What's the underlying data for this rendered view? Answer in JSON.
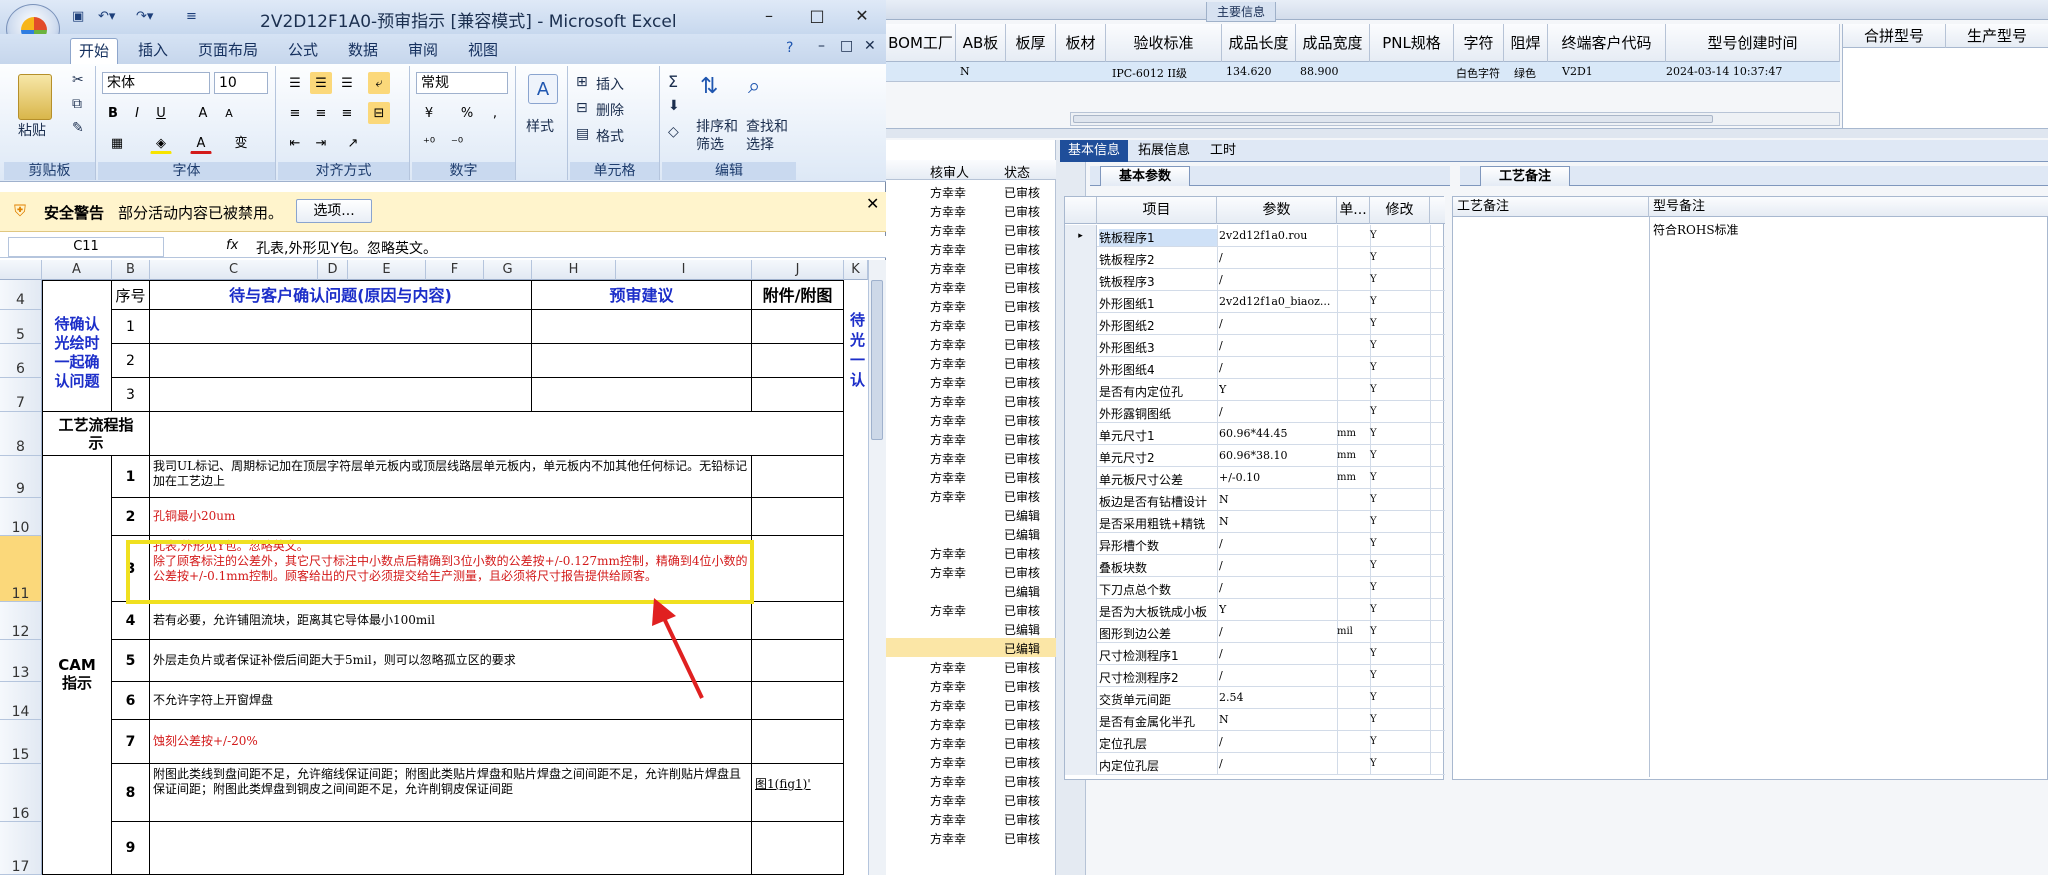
{
  "excel": {
    "title": "2V2D12F1A0-预审指示 [兼容模式] - Microsoft Excel",
    "window_buttons": [
      "–",
      "□",
      "✕"
    ],
    "ribbon_tabs": [
      "开始",
      "插入",
      "页面布局",
      "公式",
      "数据",
      "审阅",
      "视图"
    ],
    "ribbon_minor_icons": [
      "?",
      "–",
      "□",
      "✕"
    ],
    "groups": {
      "clipboard": {
        "label": "剪贴板",
        "paste": "粘贴"
      },
      "font": {
        "label": "字体",
        "name": "宋体",
        "size": "10",
        "bold": "B",
        "italic": "I",
        "underline": "U",
        "grow": "A",
        "shrink": "A",
        "wen": "变"
      },
      "align": {
        "label": "对齐方式"
      },
      "number": {
        "label": "数字",
        "format": "常规",
        "percent": "%",
        "comma": ","
      },
      "styles": {
        "label": "样式"
      },
      "cells": {
        "label": "单元格",
        "insert": "插入",
        "delete": "删除",
        "format": "格式"
      },
      "editing": {
        "label": "编辑",
        "sum": "Σ",
        "sort": "排序和",
        "sort2": "筛选",
        "find": "查找和",
        "find2": "选择"
      }
    },
    "security": {
      "title": "安全警告",
      "message": "部分活动内容已被禁用。",
      "button": "选项..."
    },
    "formula_bar": {
      "namebox": "C11",
      "fx": "fx",
      "content": "孔表,外形见Y包。忽略英文。"
    },
    "columns": [
      "A",
      "B",
      "C",
      "D",
      "E",
      "F",
      "G",
      "H",
      "I",
      "J",
      "K"
    ],
    "rows": [
      "4",
      "5",
      "6",
      "7",
      "8",
      "9",
      "10",
      "11",
      "12",
      "13",
      "14",
      "15",
      "16",
      "17"
    ],
    "header_row": {
      "seq": "序号",
      "issue": "待与客户确认问题(原因与内容)",
      "suggest": "预审建议",
      "attach": "附件/附图"
    },
    "confirm_label": "待确认光绘时一起确认问题",
    "confirm_seq": [
      "1",
      "2",
      "3"
    ],
    "process_label": "工艺流程指示",
    "cam_label": "CAM指示",
    "cam_items": [
      {
        "n": "1",
        "text": "我司UL标记、周期标记加在顶层字符层单元板内或顶层线路层单元板内，单元板内不加其他任何标记。无铅标记加在工艺边上",
        "red": false,
        "attach": ""
      },
      {
        "n": "2",
        "text": "孔铜最小20um",
        "red": true,
        "attach": ""
      },
      {
        "n": "3",
        "text": "孔表,外形见Y包。忽略英文。\n除了顾客标注的公差外，其它尺寸标注中小数点后精确到3位小数的公差按+/-0.127mm控制，精确到4位小数的公差按+/-0.1mm控制。顾客给出的尺寸必须提交给生产测量，且必须将尺寸报告提供给顾客。",
        "red": true,
        "attach": ""
      },
      {
        "n": "4",
        "text": "若有必要，允许铺阻流块，距离其它导体最小100mil",
        "red": false,
        "attach": ""
      },
      {
        "n": "5",
        "text": "外层走负片或者保证补偿后间距大于5mil，则可以忽略孤立区的要求",
        "red": false,
        "attach": ""
      },
      {
        "n": "6",
        "text": "不允许字符上开窗焊盘",
        "red": false,
        "attach": ""
      },
      {
        "n": "7",
        "text": "蚀刻公差按+/-20%",
        "red": true,
        "attach": ""
      },
      {
        "n": "8",
        "text": "附图此类线到盘间距不足，允许缩线保证间距；附图此类贴片焊盘和贴片焊盘之间间距不足，允许削贴片焊盘且保证间距；附图此类焊盘到铜皮之间间距不足，允许削铜皮保证间距",
        "red": false,
        "attach": "图1(fig1)'"
      },
      {
        "n": "9",
        "text": "",
        "red": false,
        "attach": ""
      }
    ],
    "partial_right": [
      "待",
      "光",
      "一",
      "认"
    ]
  },
  "app": {
    "top_title": "主要信息",
    "main_columns": [
      "BOM工厂",
      "AB板",
      "板厚",
      "板材",
      "验收标准",
      "成品长度",
      "成品宽度",
      "PNL规格",
      "字符",
      "阻焊",
      "终端客户代码",
      "型号创建时间"
    ],
    "main_row": {
      "bom": "N",
      "standard": "IPC-6012 II级",
      "length": "134.620",
      "width": "88.900",
      "char": "白色字符",
      "mask": "绿色",
      "client": "V2D1",
      "created": "2024-03-14 10:37:47"
    },
    "side_columns": [
      "合拼型号",
      "生产型号"
    ],
    "status_headers": [
      "核审人",
      "状态"
    ],
    "status_rows": [
      {
        "rev": "方幸幸",
        "state": "已审核"
      },
      {
        "rev": "方幸幸",
        "state": "已审核"
      },
      {
        "rev": "方幸幸",
        "state": "已审核"
      },
      {
        "rev": "方幸幸",
        "state": "已审核"
      },
      {
        "rev": "方幸幸",
        "state": "已审核"
      },
      {
        "rev": "方幸幸",
        "state": "已审核"
      },
      {
        "rev": "方幸幸",
        "state": "已审核"
      },
      {
        "rev": "方幸幸",
        "state": "已审核"
      },
      {
        "rev": "方幸幸",
        "state": "已审核"
      },
      {
        "rev": "方幸幸",
        "state": "已审核"
      },
      {
        "rev": "方幸幸",
        "state": "已审核"
      },
      {
        "rev": "方幸幸",
        "state": "已审核"
      },
      {
        "rev": "方幸幸",
        "state": "已审核"
      },
      {
        "rev": "方幸幸",
        "state": "已审核"
      },
      {
        "rev": "方幸幸",
        "state": "已审核"
      },
      {
        "rev": "方幸幸",
        "state": "已审核"
      },
      {
        "rev": "方幸幸",
        "state": "已审核"
      },
      {
        "rev": "",
        "state": "已编辑"
      },
      {
        "rev": "",
        "state": "已编辑"
      },
      {
        "rev": "方幸幸",
        "state": "已审核"
      },
      {
        "rev": "方幸幸",
        "state": "已审核"
      },
      {
        "rev": "",
        "state": "已编辑"
      },
      {
        "rev": "方幸幸",
        "state": "已审核"
      },
      {
        "rev": "",
        "state": "已编辑"
      },
      {
        "rev": "",
        "state": "已编辑"
      },
      {
        "rev": "方幸幸",
        "state": "已审核"
      },
      {
        "rev": "方幸幸",
        "state": "已审核"
      },
      {
        "rev": "方幸幸",
        "state": "已审核"
      },
      {
        "rev": "方幸幸",
        "state": "已审核"
      },
      {
        "rev": "方幸幸",
        "state": "已审核"
      },
      {
        "rev": "方幸幸",
        "state": "已审核"
      },
      {
        "rev": "方幸幸",
        "state": "已审核"
      },
      {
        "rev": "方幸幸",
        "state": "已审核"
      },
      {
        "rev": "方幸幸",
        "state": "已审核"
      },
      {
        "rev": "方幸幸",
        "state": "已审核"
      }
    ],
    "tabs": [
      "基本信息",
      "拓展信息",
      "工时"
    ],
    "subtab_basic": "基本参数",
    "subtab_craft": "工艺备注",
    "param_headers": [
      "项目",
      "参数",
      "单...",
      "修改"
    ],
    "params": [
      {
        "k": "铣板程序1",
        "v": "2v2d12f1a0.rou",
        "u": "",
        "m": "Y"
      },
      {
        "k": "铣板程序2",
        "v": "/",
        "u": "",
        "m": "Y"
      },
      {
        "k": "铣板程序3",
        "v": "/",
        "u": "",
        "m": "Y"
      },
      {
        "k": "外形图纸1",
        "v": "2v2d12f1a0_biaoz...",
        "u": "",
        "m": "Y"
      },
      {
        "k": "外形图纸2",
        "v": "/",
        "u": "",
        "m": "Y"
      },
      {
        "k": "外形图纸3",
        "v": "/",
        "u": "",
        "m": "Y"
      },
      {
        "k": "外形图纸4",
        "v": "/",
        "u": "",
        "m": "Y"
      },
      {
        "k": "是否有内定位孔",
        "v": "Y",
        "u": "",
        "m": "Y"
      },
      {
        "k": "外形露铜图纸",
        "v": "/",
        "u": "",
        "m": "Y"
      },
      {
        "k": "单元尺寸1",
        "v": "60.96*44.45",
        "u": "mm",
        "m": "Y"
      },
      {
        "k": "单元尺寸2",
        "v": "60.96*38.10",
        "u": "mm",
        "m": "Y"
      },
      {
        "k": "单元板尺寸公差",
        "v": "+/-0.10",
        "u": "mm",
        "m": "Y"
      },
      {
        "k": "板边是否有钻槽设计",
        "v": "N",
        "u": "",
        "m": "Y"
      },
      {
        "k": "是否采用粗铣+精铣",
        "v": "N",
        "u": "",
        "m": "Y"
      },
      {
        "k": "异形槽个数",
        "v": "/",
        "u": "",
        "m": "Y"
      },
      {
        "k": "叠板块数",
        "v": "/",
        "u": "",
        "m": "Y"
      },
      {
        "k": "下刀点总个数",
        "v": "/",
        "u": "",
        "m": "Y"
      },
      {
        "k": "是否为大板铣成小板",
        "v": "Y",
        "u": "",
        "m": "Y"
      },
      {
        "k": "图形到边公差",
        "v": "/",
        "u": "mil",
        "m": "Y"
      },
      {
        "k": "尺寸检测程序1",
        "v": "/",
        "u": "",
        "m": "Y"
      },
      {
        "k": "尺寸检测程序2",
        "v": "/",
        "u": "",
        "m": "Y"
      },
      {
        "k": "交货单元间距",
        "v": "2.54",
        "u": "",
        "m": "Y"
      },
      {
        "k": "是否有金属化半孔",
        "v": "N",
        "u": "",
        "m": "Y"
      },
      {
        "k": "定位孔层",
        "v": "/",
        "u": "",
        "m": "Y"
      },
      {
        "k": "内定位孔层",
        "v": "/",
        "u": "",
        "m": "Y"
      }
    ],
    "craft_headers": [
      "工艺备注",
      "型号备注"
    ],
    "craft_note": "符合ROHS标准"
  },
  "colors": {
    "accent": "#1f4e9a",
    "highlight": "#f0e020",
    "arrow": "#e02020",
    "blue_text": "#1c2ec9",
    "red_text": "#d31a1a"
  }
}
